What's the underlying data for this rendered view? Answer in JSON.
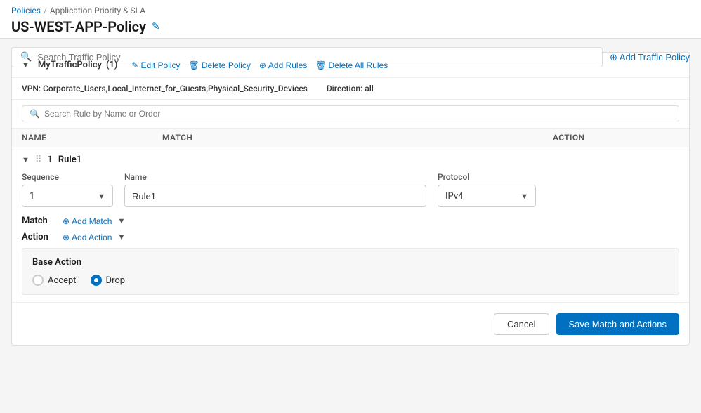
{
  "breadcrumb": {
    "link_label": "Policies",
    "separator": "/",
    "current": "Application Priority & SLA"
  },
  "page": {
    "title": "US-WEST-APP-Policy",
    "edit_icon": "✎"
  },
  "search_traffic": {
    "placeholder": "Search Traffic Policy"
  },
  "add_traffic_btn": "⊕ Add Traffic Policy",
  "policy": {
    "title": "MyTrafficPolicy",
    "count": "(1)",
    "edit_label": "Edit Policy",
    "delete_label": "Delete Policy",
    "add_rules_label": "Add Rules",
    "delete_all_label": "Delete All Rules",
    "vpn_label": "VPN:",
    "vpn_value": "Corporate_Users,Local_Internet_for_Guests,Physical_Security_Devices",
    "direction_label": "Direction:",
    "direction_value": "all"
  },
  "rule_search": {
    "placeholder": "Search Rule by Name or Order"
  },
  "table_headers": {
    "name": "NAME",
    "match": "MATCH",
    "action": "ACTION"
  },
  "rule": {
    "number": "1",
    "name": "Rule1",
    "sequence_label": "Sequence",
    "sequence_value": "1",
    "name_label": "Name",
    "name_value": "Rule1",
    "protocol_label": "Protocol",
    "protocol_value": "IPv4",
    "match_label": "Match",
    "add_match_label": "Add Match",
    "action_label": "Action",
    "add_action_label": "Add Action",
    "base_action_title": "Base Action",
    "radio_accept": "Accept",
    "radio_drop": "Drop"
  },
  "footer": {
    "cancel_label": "Cancel",
    "save_label": "Save Match and Actions"
  },
  "colors": {
    "primary": "#0070c0",
    "selected_radio": "#0070c0"
  }
}
